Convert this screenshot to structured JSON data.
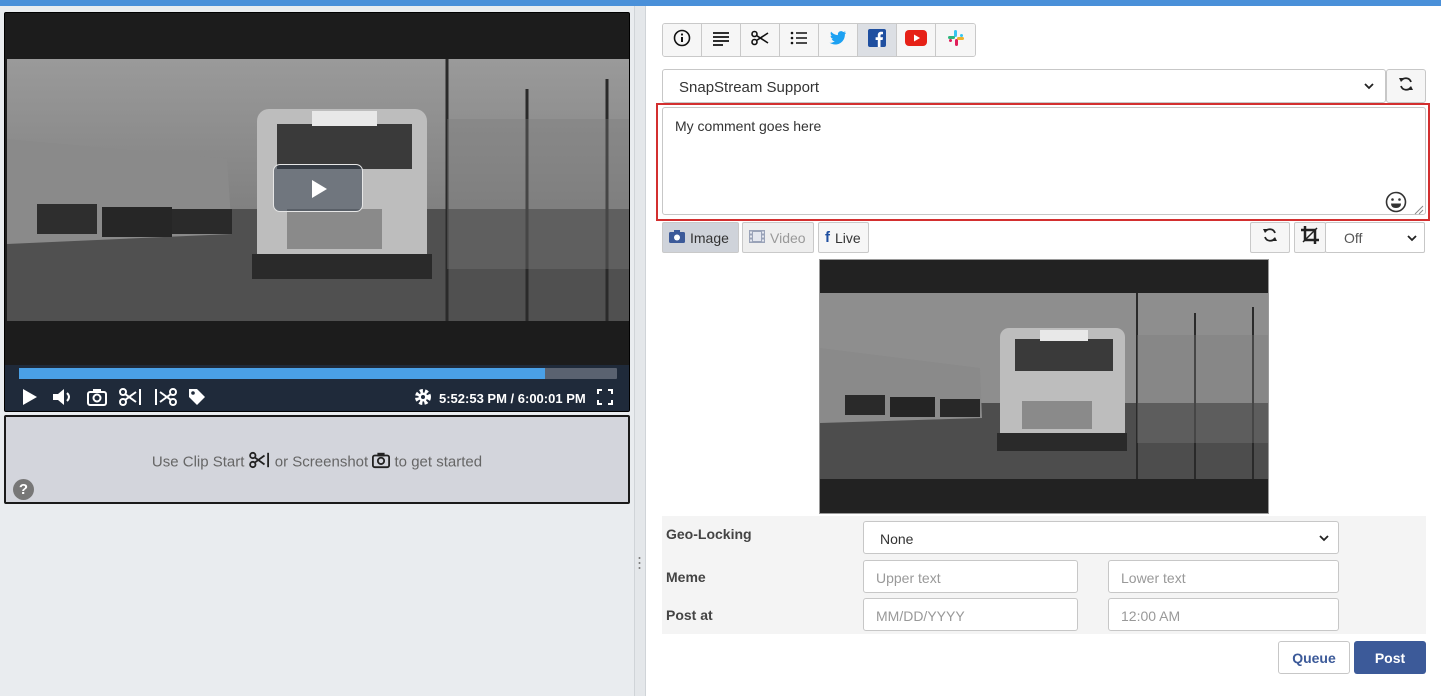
{
  "player": {
    "current_time": "5:52:53 PM",
    "total_time": "/ 6:00:01 PM",
    "progress": 0.88
  },
  "clip_box": {
    "text_start": "Use Clip Start",
    "text_middle": "or Screenshot",
    "text_end": "to get started"
  },
  "toolbar": {
    "tabs": [
      {
        "name": "info-icon",
        "active": false
      },
      {
        "name": "text-lines-icon",
        "active": false
      },
      {
        "name": "scissors-icon",
        "active": false
      },
      {
        "name": "list-icon",
        "active": false
      },
      {
        "name": "twitter-icon",
        "active": false
      },
      {
        "name": "facebook-icon",
        "active": true
      },
      {
        "name": "youtube-icon",
        "active": false
      },
      {
        "name": "slack-icon",
        "active": false
      }
    ]
  },
  "account_select": {
    "value": "SnapStream Support"
  },
  "comment": {
    "value": "My comment goes here"
  },
  "media": {
    "image_label": "Image",
    "video_label": "Video",
    "live_label": "Live",
    "crop_value": "Off"
  },
  "form": {
    "geo_label": "Geo-Locking",
    "geo_value": "None",
    "meme_label": "Meme",
    "upper_placeholder": "Upper text",
    "lower_placeholder": "Lower text",
    "post_at_label": "Post at",
    "date_placeholder": "MM/DD/YYYY",
    "time_placeholder": "12:00 AM"
  },
  "actions": {
    "queue": "Queue",
    "post": "Post"
  },
  "colors": {
    "accent": "#3c5a99",
    "highlight": "#d32f2f",
    "progress": "#4aa0e6"
  }
}
